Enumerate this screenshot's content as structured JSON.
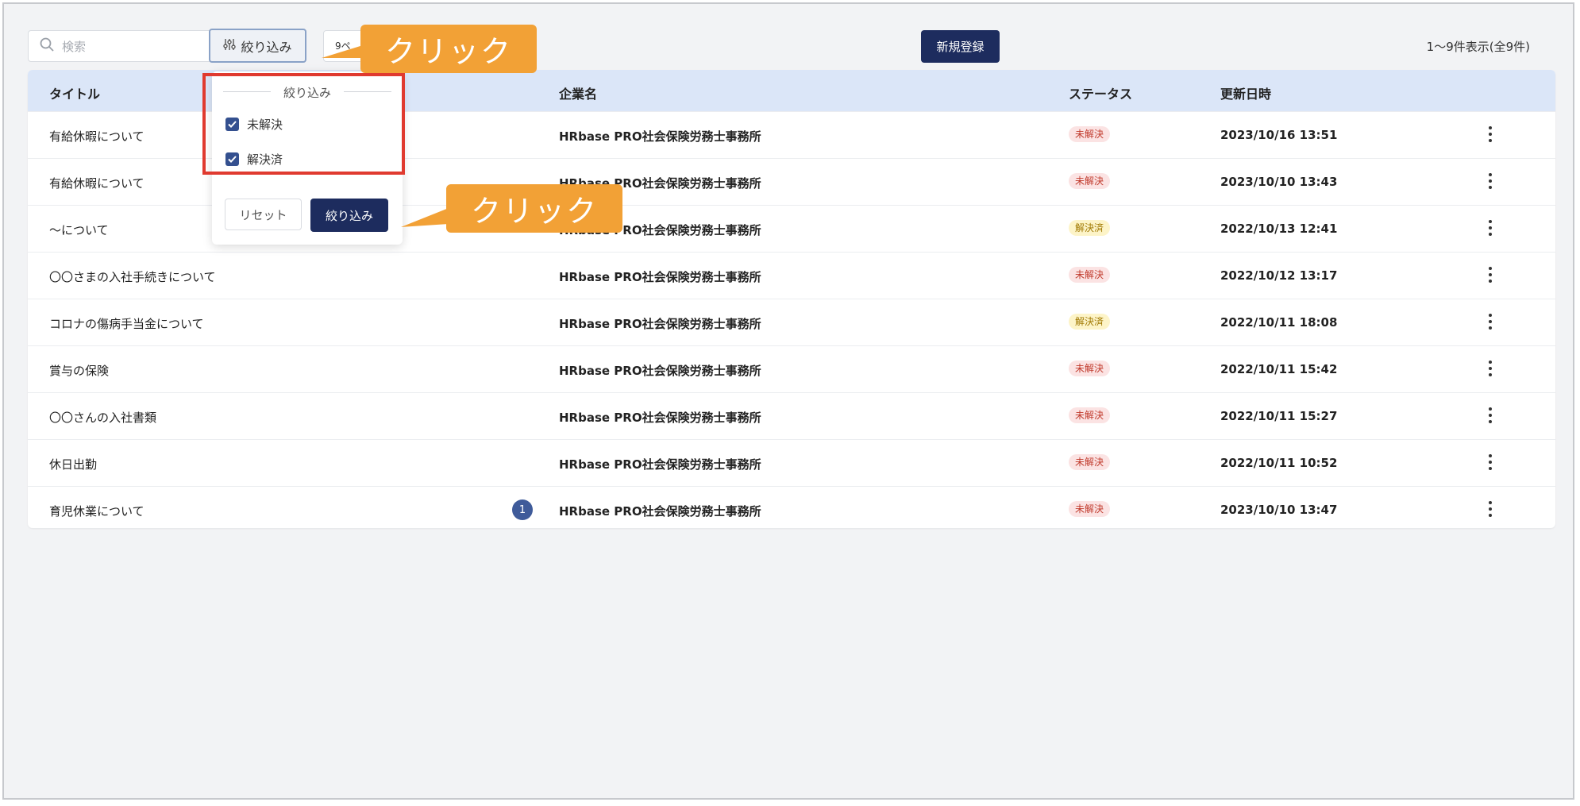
{
  "search": {
    "placeholder": "検索"
  },
  "toolbar": {
    "filter_label": "絞り込み",
    "per_page_label": "9ペ",
    "new_label": "新規登録",
    "count_text": "1～9件表示(全9件)"
  },
  "table": {
    "headers": {
      "title": "タイトル",
      "company": "企業名",
      "status": "ステータス",
      "updated": "更新日時"
    },
    "rows": [
      {
        "title": "有給休暇について",
        "company": "HRbase PRO社会保険労務士事務所",
        "status": "未解決",
        "updated": "2023/10/16 13:51"
      },
      {
        "title": "有給休暇について",
        "company": "HRbase PRO社会保険労務士事務所",
        "status": "未解決",
        "updated": "2023/10/10 13:43"
      },
      {
        "title": "〜について",
        "company": "HRbase PRO社会保険労務士事務所",
        "status": "解決済",
        "updated": "2022/10/13 12:41"
      },
      {
        "title": "〇〇さまの入社手続きについて",
        "company": "HRbase PRO社会保険労務士事務所",
        "status": "未解決",
        "updated": "2022/10/12 13:17"
      },
      {
        "title": "コロナの傷病手当金について",
        "company": "HRbase PRO社会保険労務士事務所",
        "status": "解決済",
        "updated": "2022/10/11 18:08"
      },
      {
        "title": "賞与の保険",
        "company": "HRbase PRO社会保険労務士事務所",
        "status": "未解決",
        "updated": "2022/10/11 15:42"
      },
      {
        "title": "〇〇さんの入社書類",
        "company": "HRbase PRO社会保険労務士事務所",
        "status": "未解決",
        "updated": "2022/10/11 15:27"
      },
      {
        "title": "休日出勤",
        "company": "HRbase PRO社会保険労務士事務所",
        "status": "未解決",
        "updated": "2022/10/11 10:52"
      },
      {
        "title": "育児休業について",
        "company": "HRbase PRO社会保険労務士事務所",
        "status": "未解決",
        "updated": "2023/10/10 13:47",
        "unread": "1"
      }
    ]
  },
  "dropdown": {
    "title": "絞り込み",
    "options": [
      {
        "label": "未解決",
        "checked": true
      },
      {
        "label": "解決済",
        "checked": true
      }
    ],
    "reset_label": "リセット",
    "apply_label": "絞り込み"
  },
  "callouts": {
    "first": "クリック",
    "second": "クリック"
  },
  "colors": {
    "primary": "#1d2c5e",
    "accent": "#f2a136",
    "highlight": "#e03a2f",
    "header_bg": "#dbe6f8"
  }
}
